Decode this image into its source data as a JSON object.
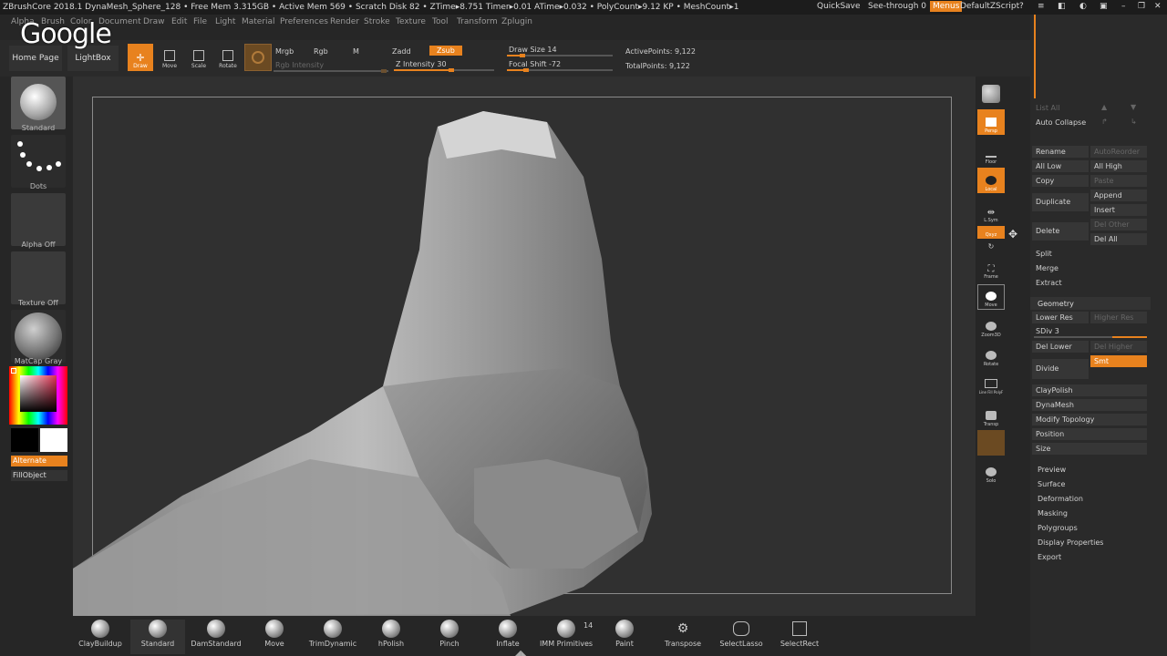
{
  "titlebar": {
    "title": "ZBrushCore 2018.1   DynaMesh_Sphere_128   • Free Mem 3.315GB • Active Mem 569 • Scratch Disk 82 • ZTime▸8.751 Timer▸0.01 ATime▸0.032 • PolyCount▸9.12 KP  • MeshCount▸1",
    "quicksave": "QuickSave",
    "see_through": "See-through  0",
    "menus": "Menus",
    "defaultzscript": "DefaultZScript"
  },
  "menubar": [
    "Alpha",
    "Brush",
    "Color",
    "Document",
    "Draw",
    "Edit",
    "File",
    "Light",
    "Material",
    "Preferences",
    "Render",
    "Stroke",
    "Texture",
    "Tool",
    "Transform",
    "Zplugin"
  ],
  "logo": "Google",
  "topshelf": {
    "home_page": "Home Page",
    "lightbox": "LightBox",
    "tools": [
      {
        "label": "Draw",
        "active": true
      },
      {
        "label": "Move",
        "active": false
      },
      {
        "label": "Scale",
        "active": false
      },
      {
        "label": "Rotate",
        "active": false
      }
    ],
    "mrgb": "Mrgb",
    "rgb": "Rgb",
    "m": "M",
    "zadd": "Zadd",
    "zsub": "Zsub",
    "rgb_intensity": "Rgb Intensity",
    "z_intensity": "Z Intensity 30",
    "draw_size": "Draw Size 14",
    "focal_shift": "Focal Shift -72",
    "active_points": "ActivePoints: 9,122",
    "total_points": "TotalPoints: 9,122"
  },
  "leftpanel": {
    "standard": "Standard",
    "dots": "Dots",
    "alpha_off": "Alpha Off",
    "texture_off": "Texture Off",
    "matcap_gray": "MatCap Gray",
    "alternate": "Alternate",
    "fillobject": "FillObject"
  },
  "rightdock": [
    {
      "label": "Persp",
      "orange": true
    },
    {
      "label": "Floor",
      "orange": false
    },
    {
      "label": "Local",
      "orange": true
    },
    {
      "label": "L.Sym",
      "orange": false
    },
    {
      "label": "Qxyz",
      "orange": true
    },
    {
      "label": "Frame",
      "orange": false
    },
    {
      "label": "Move",
      "orange": false
    },
    {
      "label": "Zoom3D",
      "orange": false
    },
    {
      "label": "Rotate",
      "orange": false
    },
    {
      "label": "Line Fill PolyF",
      "orange": false
    },
    {
      "label": "Transp",
      "orange": false
    },
    {
      "label": "Solo",
      "orange": false
    }
  ],
  "subtool": {
    "list_all": "List All",
    "auto_collapse": "Auto Collapse",
    "rename": "Rename",
    "autoreorder": "AutoReorder",
    "all_low": "All Low",
    "all_high": "All High",
    "copy": "Copy",
    "paste": "Paste",
    "duplicate": "Duplicate",
    "append": "Append",
    "insert": "Insert",
    "delete": "Delete",
    "del_other": "Del Other",
    "del_all": "Del All",
    "split": "Split",
    "merge": "Merge",
    "extract": "Extract"
  },
  "geometry": {
    "title": "Geometry",
    "lower_res": "Lower Res",
    "higher_res": "Higher Res",
    "sdiv": "SDiv 3",
    "del_lower": "Del Lower",
    "del_higher": "Del Higher",
    "divide": "Divide",
    "smt": "Smt",
    "claypolish": "ClayPolish",
    "dynamesh": "DynaMesh",
    "modify_topology": "Modify Topology",
    "position": "Position",
    "size": "Size"
  },
  "sections": [
    "Preview",
    "Surface",
    "Deformation",
    "Masking",
    "Polygroups",
    "Display Properties",
    "Export"
  ],
  "brushes": [
    {
      "label": "ClayBuildup",
      "sel": false
    },
    {
      "label": "Standard",
      "sel": true
    },
    {
      "label": "DamStandard",
      "sel": false
    },
    {
      "label": "Move",
      "sel": false
    },
    {
      "label": "TrimDynamic",
      "sel": false
    },
    {
      "label": "hPolish",
      "sel": false
    },
    {
      "label": "Pinch",
      "sel": false
    },
    {
      "label": "Inflate",
      "sel": false
    },
    {
      "label": "IMM Primitives",
      "sel": false
    },
    {
      "label": "Paint",
      "sel": false
    },
    {
      "label": "Transpose",
      "sel": false
    },
    {
      "label": "SelectLasso",
      "sel": false
    },
    {
      "label": "SelectRect",
      "sel": false
    }
  ],
  "imm_count": "14"
}
